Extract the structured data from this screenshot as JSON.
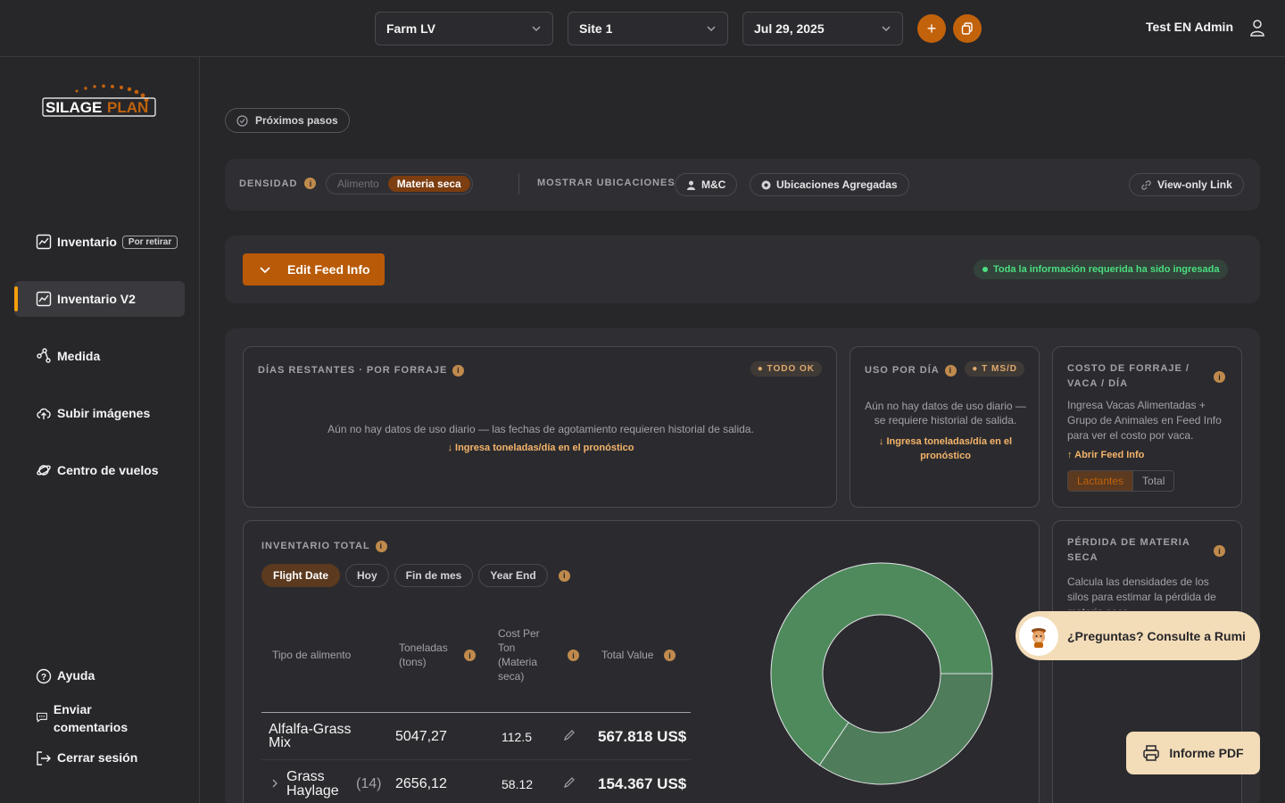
{
  "header": {
    "farm_select": "Farm LV",
    "site_select": "Site 1",
    "date_select": "Jul 29, 2025",
    "add_button": "+",
    "user_name": "Test EN Admin"
  },
  "sidebar": {
    "logo_text": "SILAGEPLAN",
    "items": [
      {
        "label": "Inventario",
        "badge": "Por retirar"
      },
      {
        "label": "Inventario V2"
      },
      {
        "label": "Medida"
      },
      {
        "label": "Subir imágenes"
      },
      {
        "label": "Centro de vuelos"
      }
    ],
    "bottom": {
      "help": "Ayuda",
      "feedback": "Enviar comentarios",
      "logout": "Cerrar sesión"
    }
  },
  "main": {
    "next_steps": "Próximos pasos",
    "controls": {
      "density_label": "DENSIDAD",
      "density_options": [
        "Alimento",
        "Materia seca"
      ],
      "show_locations_label": "MOSTRAR UBICACIONES",
      "mc_button": "M&C",
      "aggregated_button": "Ubicaciones Agregadas",
      "view_only_link": "View-only Link"
    },
    "feed": {
      "edit_button": "Edit Feed Info",
      "status": "Toda la información requerida ha sido ingresada"
    },
    "dias": {
      "title": "DÍAS RESTANTES · POR FORRAJE",
      "badge": "TODO OK",
      "message": "Aún no hay datos de uso diario — las fechas de agotamiento requieren historial de salida.",
      "link": "↓ Ingresa toneladas/día en el pronóstico"
    },
    "uso": {
      "title": "USO POR DÍA",
      "badge": "T MS/D",
      "message": "Aún no hay datos de uso diario — se requiere historial de salida.",
      "link": "↓ Ingresa toneladas/día en el pronóstico"
    },
    "costo": {
      "title": "COSTO DE FORRAJE / VACA / DÍA",
      "message": "Ingresa Vacas Alimentadas + Grupo de Animales en Feed Info para ver el costo por vaca.",
      "link": "↑ Abrir Feed Info",
      "toggle": [
        "Lactantes",
        "Total"
      ]
    },
    "inventario": {
      "title": "INVENTARIO TOTAL",
      "tabs": [
        "Flight Date",
        "Hoy",
        "Fin de mes",
        "Year End"
      ],
      "headers": {
        "type": "Tipo de alimento",
        "tons": "Toneladas (tons)",
        "cost": "Cost Per Ton (Materia seca)",
        "total": "Total Value"
      },
      "rows": [
        {
          "name": "Alfalfa-Grass Mix",
          "count": "",
          "tons": "5047,27",
          "cost": "112.5",
          "total": "567.818 US$"
        },
        {
          "name": "Grass Haylage",
          "count": "(14)",
          "tons": "2656,12",
          "cost": "58.12",
          "total": "154.367 US$"
        }
      ]
    },
    "perdida": {
      "title": "PÉRDIDA DE MATERIA SECA",
      "message": "Calcula las densidades de los silos para estimar la pérdida de materia seca."
    },
    "rumi": "¿Preguntas? Consulte a Rumi",
    "pdf": "Informe PDF"
  },
  "chart_data": {
    "type": "pie",
    "categories": [
      "Alfalfa-Grass Mix",
      "Grass Haylage"
    ],
    "values": [
      5047.27,
      2656.12
    ],
    "colors": [
      "#4e8a5c",
      "#4f7c5a"
    ]
  },
  "colors": {
    "accent": "#c2620b",
    "background": "#27272a",
    "rumi": "#f3dcb8"
  }
}
